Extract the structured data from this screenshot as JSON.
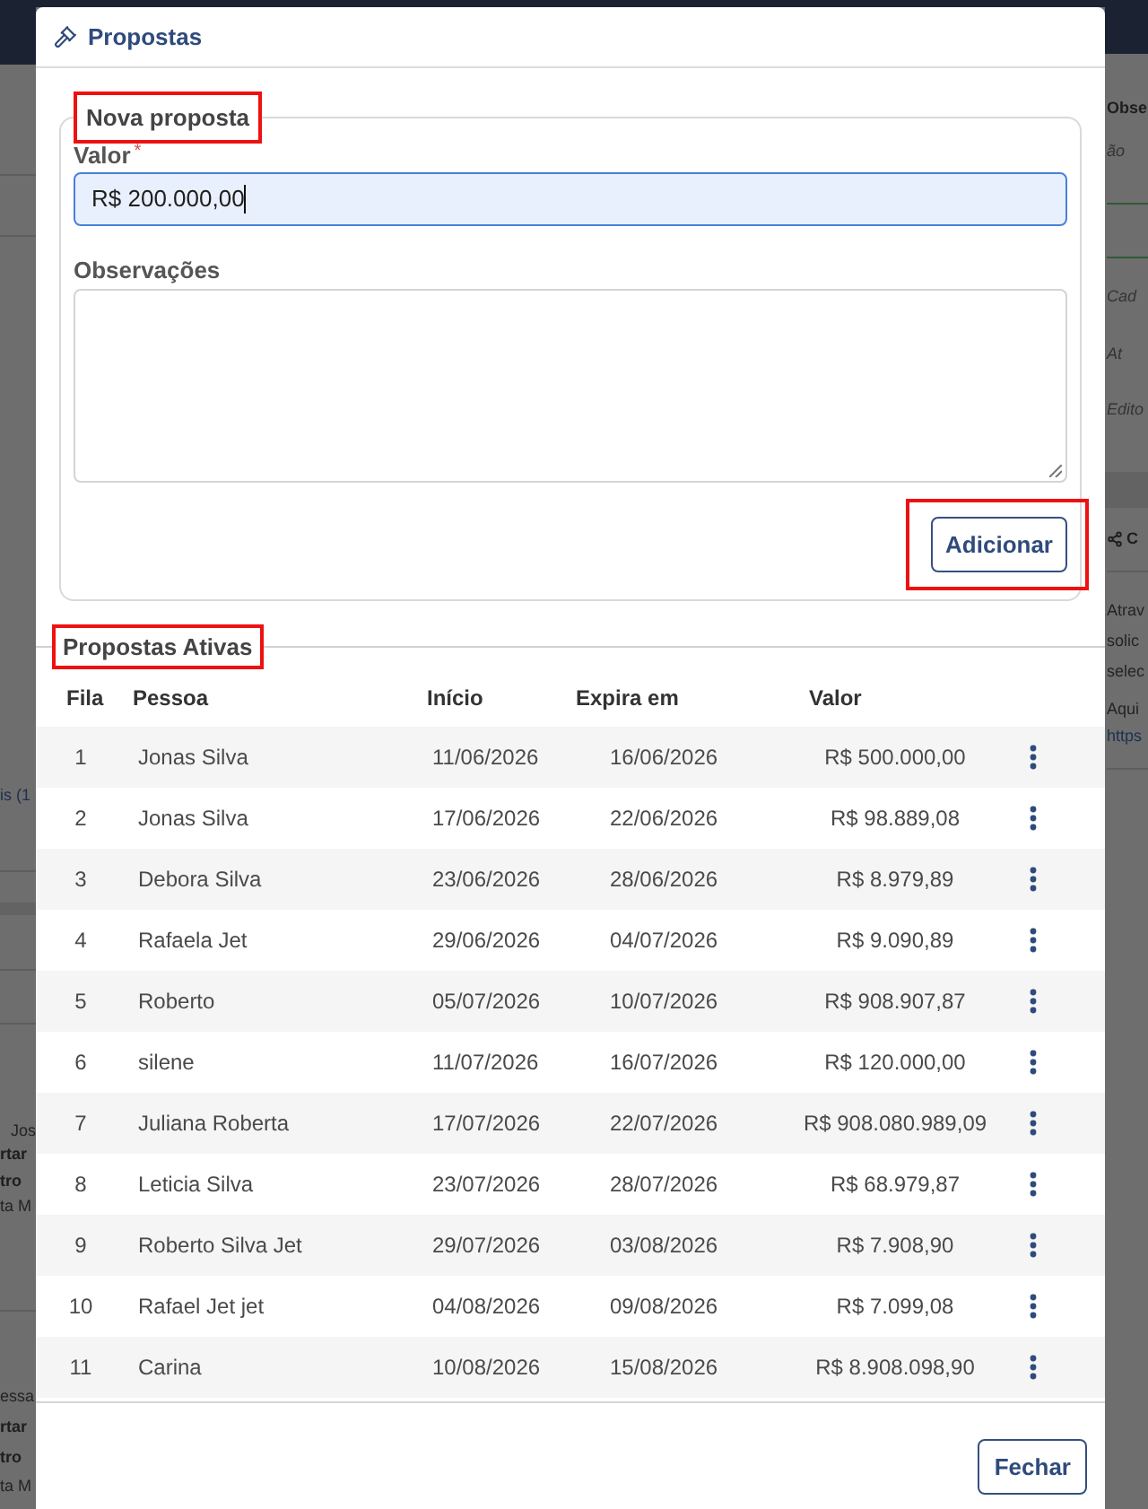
{
  "background_page": {
    "left_fragments": [
      {
        "text": "is (1",
        "kind": "link"
      },
      {
        "text": "Jos",
        "kind": "plain"
      },
      {
        "text": "rtar",
        "kind": "bold"
      },
      {
        "text": "tro",
        "kind": "bold"
      },
      {
        "text": "ta M",
        "kind": "plain"
      },
      {
        "text": "essa",
        "kind": "plain"
      },
      {
        "text": "rtar",
        "kind": "bold"
      },
      {
        "text": "tro",
        "kind": "bold"
      },
      {
        "text": "ta M",
        "kind": "plain"
      }
    ],
    "right_fragments": [
      {
        "text": "Obse",
        "kind": "bold"
      },
      {
        "text": "ão",
        "kind": "italic"
      },
      {
        "text": "Cad",
        "kind": "italic"
      },
      {
        "text": "At",
        "kind": "italic"
      },
      {
        "text": "Edito",
        "kind": "italic"
      },
      {
        "text": "C",
        "kind": "heading"
      },
      {
        "text": "Atrav",
        "kind": "plain"
      },
      {
        "text": "solic",
        "kind": "plain"
      },
      {
        "text": "selec",
        "kind": "plain"
      },
      {
        "text": "Aqui",
        "kind": "plain"
      },
      {
        "text": "https",
        "kind": "link"
      }
    ]
  },
  "dialog": {
    "title": "Propostas",
    "new_proposal": {
      "legend": "Nova proposta",
      "highlighted": true,
      "value_field": {
        "label": "Valor",
        "required_mark": "*",
        "value": "R$ 200.000,00",
        "focused": true
      },
      "notes_field": {
        "label": "Observações"
      },
      "add_button": {
        "label": "Adicionar",
        "highlighted": true
      }
    },
    "active_proposals": {
      "legend": "Propostas Ativas",
      "highlighted": true,
      "table": {
        "columns": [
          "Fila",
          "Pessoa",
          "Início",
          "Expira em",
          "Valor"
        ],
        "rows": [
          {
            "fila": "1",
            "pessoa": "Jonas Silva",
            "inicio": "11/06/2026",
            "expira": "16/06/2026",
            "valor": "R$ 500.000,00"
          },
          {
            "fila": "2",
            "pessoa": "Jonas Silva",
            "inicio": "17/06/2026",
            "expira": "22/06/2026",
            "valor": "R$ 98.889,08"
          },
          {
            "fila": "3",
            "pessoa": "Debora Silva",
            "inicio": "23/06/2026",
            "expira": "28/06/2026",
            "valor": "R$ 8.979,89"
          },
          {
            "fila": "4",
            "pessoa": "Rafaela Jet",
            "inicio": "29/06/2026",
            "expira": "04/07/2026",
            "valor": "R$ 9.090,89"
          },
          {
            "fila": "5",
            "pessoa": "Roberto",
            "inicio": "05/07/2026",
            "expira": "10/07/2026",
            "valor": "R$ 908.907,87"
          },
          {
            "fila": "6",
            "pessoa": "silene",
            "inicio": "11/07/2026",
            "expira": "16/07/2026",
            "valor": "R$ 120.000,00"
          },
          {
            "fila": "7",
            "pessoa": "Juliana Roberta",
            "inicio": "17/07/2026",
            "expira": "22/07/2026",
            "valor": "R$ 908.080.989,09"
          },
          {
            "fila": "8",
            "pessoa": "Leticia Silva",
            "inicio": "23/07/2026",
            "expira": "28/07/2026",
            "valor": "R$ 68.979,87"
          },
          {
            "fila": "9",
            "pessoa": "Roberto Silva Jet",
            "inicio": "29/07/2026",
            "expira": "03/08/2026",
            "valor": "R$ 7.908,90"
          },
          {
            "fila": "10",
            "pessoa": "Rafael Jet jet",
            "inicio": "04/08/2026",
            "expira": "09/08/2026",
            "valor": "R$ 7.099,08"
          },
          {
            "fila": "11",
            "pessoa": "Carina",
            "inicio": "10/08/2026",
            "expira": "15/08/2026",
            "valor": "R$ 8.908.098,90"
          }
        ]
      }
    },
    "close_button": "Fechar"
  }
}
